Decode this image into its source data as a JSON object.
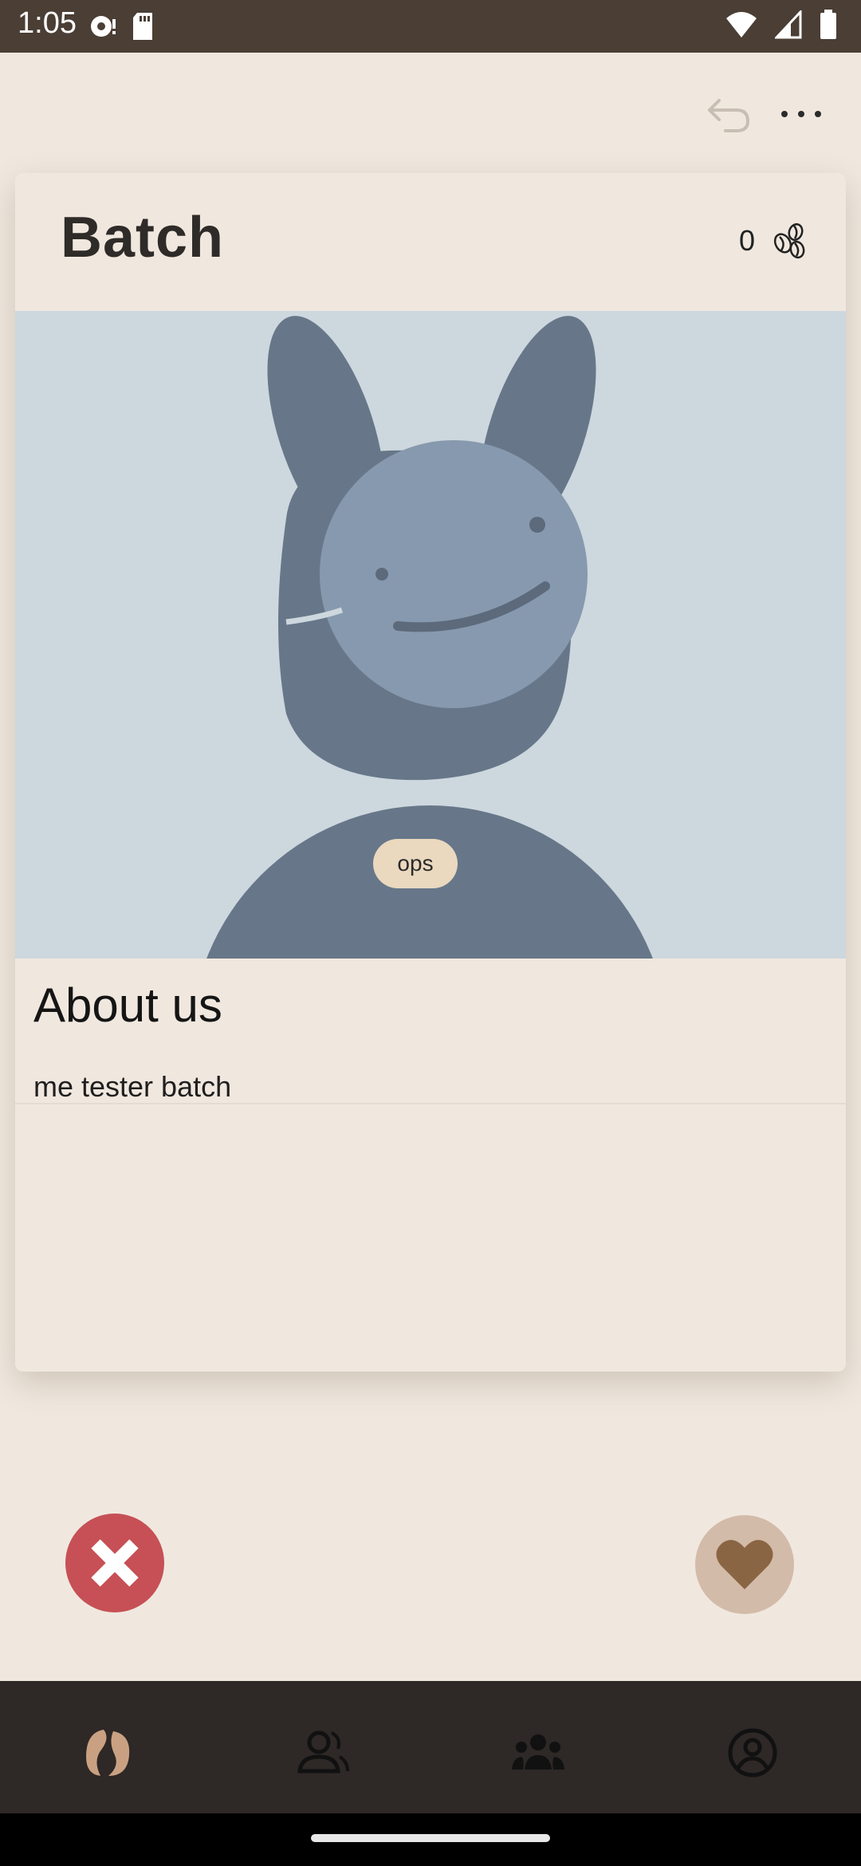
{
  "status_bar": {
    "time": "1:05",
    "icons": [
      "messaging-icon",
      "sd-card-icon",
      "wifi-icon",
      "cell-signal-icon",
      "battery-icon"
    ]
  },
  "app_bar": {
    "actions": [
      "undo-icon",
      "more-options-icon"
    ]
  },
  "profile": {
    "name": "Batch",
    "bean_count": "0",
    "photo": "default-avatar-placeholder",
    "tags": [
      "ops"
    ],
    "about_title": "About us",
    "about_text": "me tester batch"
  },
  "actions": {
    "reject_icon": "close-icon",
    "like_icon": "heart-icon"
  },
  "bottom_nav": {
    "items": [
      "beans-tab-icon",
      "person-tab-icon",
      "group-tab-icon",
      "account-tab-icon"
    ],
    "active": 0
  },
  "colors": {
    "background": "#f0e8df",
    "status_bar": "#4a3e35",
    "reject": "#c65055",
    "like": "#d3bba9",
    "like_heart": "#8a6543",
    "nav_bg": "#2e2826",
    "nav_active": "#c9a182",
    "tag": "#ead8bf"
  }
}
